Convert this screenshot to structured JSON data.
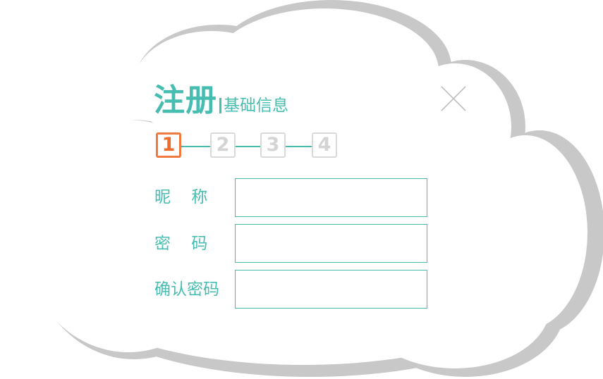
{
  "dialog": {
    "title": "注册",
    "subtitle": "基础信息",
    "close_icon": "close-icon",
    "colors": {
      "accent": "#47bdb1",
      "active_step": "#f07a3e",
      "inactive_step": "#d9d9d9",
      "cloud_shadow": "#c8c8c8"
    }
  },
  "steps": {
    "current": 1,
    "items": [
      {
        "label": "1",
        "state": "active"
      },
      {
        "label": "2",
        "state": "inactive"
      },
      {
        "label": "3",
        "state": "inactive"
      },
      {
        "label": "4",
        "state": "inactive"
      }
    ]
  },
  "form": {
    "fields": [
      {
        "label": "昵    称",
        "value": "",
        "placeholder": ""
      },
      {
        "label": "密    码",
        "value": "",
        "placeholder": ""
      },
      {
        "label": "确认密码",
        "value": "",
        "placeholder": ""
      }
    ]
  }
}
